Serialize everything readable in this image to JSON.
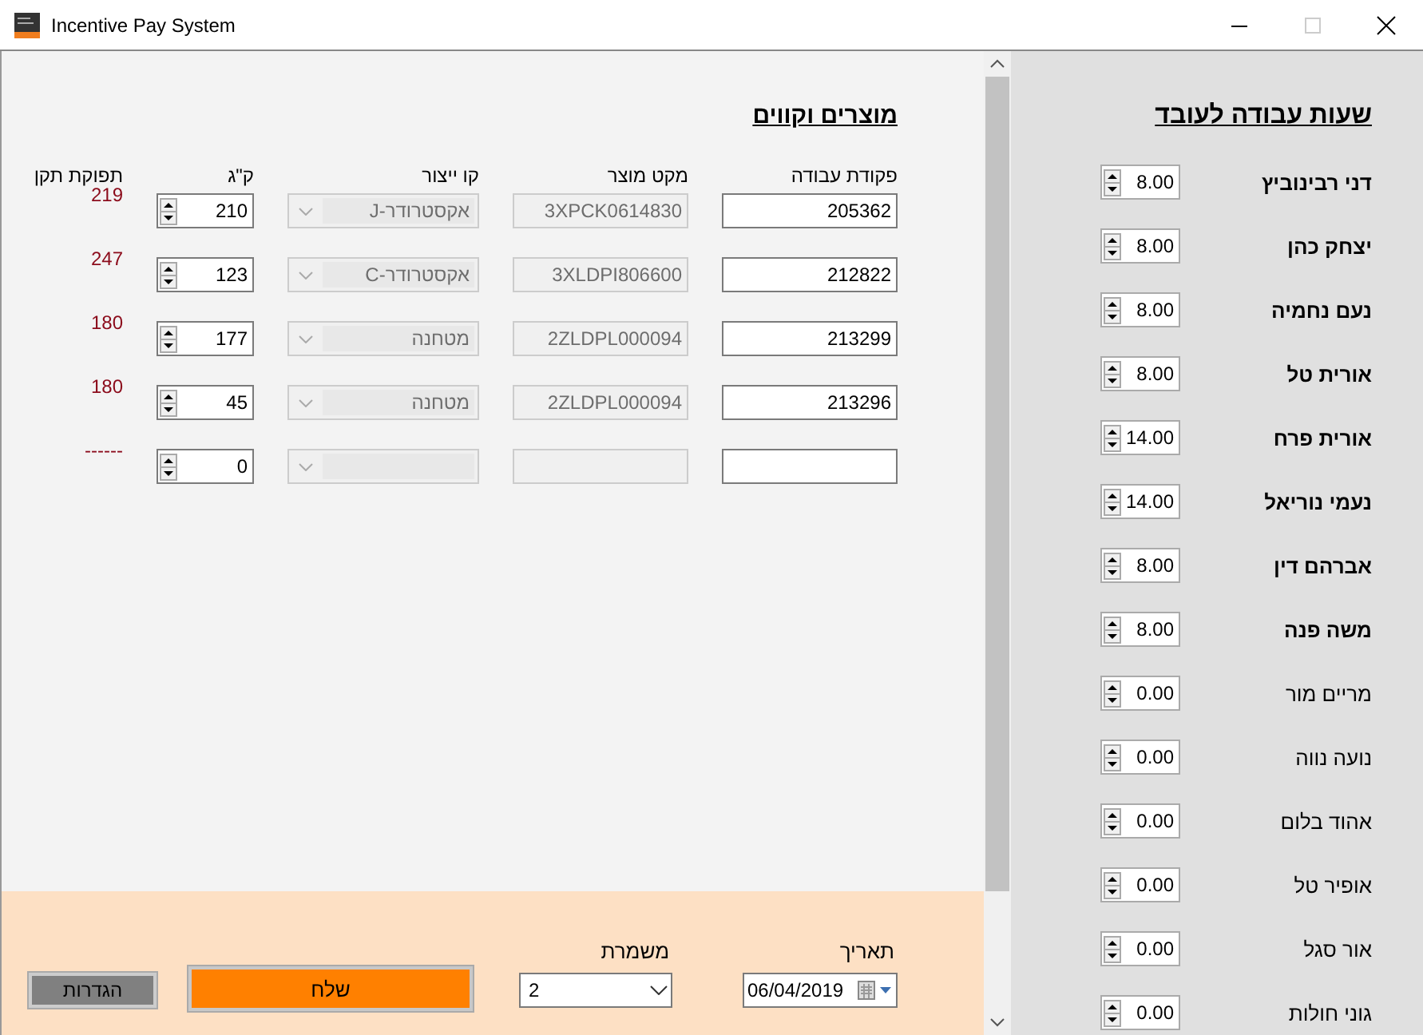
{
  "window": {
    "title": "Incentive Pay System"
  },
  "products": {
    "title": "מוצרים וקווים",
    "columns": [
      "פקודת עבודה",
      "מקט מוצר",
      "קו ייצור",
      "ק\"ג",
      "תפוקת תקן"
    ],
    "rows": [
      {
        "work_order": "205362",
        "product_code": "3XPCK0614830",
        "line": "אקסטרודר-J",
        "kg": "210",
        "standard_output": "219"
      },
      {
        "work_order": "212822",
        "product_code": "3XLDPI806600",
        "line": "אקסטרודר-C",
        "kg": "123",
        "standard_output": "247"
      },
      {
        "work_order": "213299",
        "product_code": "2ZLDPL000094",
        "line": "מטחנה",
        "kg": "177",
        "standard_output": "180"
      },
      {
        "work_order": "213296",
        "product_code": "2ZLDPL000094",
        "line": "מטחנה",
        "kg": "45",
        "standard_output": "180"
      },
      {
        "kg": "0",
        "standard_output": "------"
      }
    ]
  },
  "footer": {
    "date_label": "תאריך",
    "date": "06/04/2019",
    "shift_label": "משמרת",
    "shift": "2",
    "send_button": "שלח",
    "settings_button": "הגדרות"
  },
  "hours": {
    "title": "שעות עבודה לעובד",
    "employees": [
      {
        "name": "דני רבינוביץ",
        "hours": "8.00",
        "active": true
      },
      {
        "name": "יצחק כהן",
        "hours": "8.00",
        "active": true
      },
      {
        "name": "נעם נחמיה",
        "hours": "8.00",
        "active": true
      },
      {
        "name": "אורית טל",
        "hours": "8.00",
        "active": true
      },
      {
        "name": "אורית פרח",
        "hours": "14.00",
        "active": true
      },
      {
        "name": "נעמי נוריאל",
        "hours": "14.00",
        "active": true
      },
      {
        "name": "אברהם דין",
        "hours": "8.00",
        "active": true
      },
      {
        "name": "משה פנה",
        "hours": "8.00",
        "active": true
      },
      {
        "name": "מריים מור",
        "hours": "0.00",
        "active": false
      },
      {
        "name": "נועה נווה",
        "hours": "0.00",
        "active": false
      },
      {
        "name": "אהוד בלום",
        "hours": "0.00",
        "active": false
      },
      {
        "name": "אופיר טל",
        "hours": "0.00",
        "active": false
      },
      {
        "name": "אור סגל",
        "hours": "0.00",
        "active": false
      },
      {
        "name": "גוני חולות",
        "hours": "0.00",
        "active": false
      }
    ]
  }
}
